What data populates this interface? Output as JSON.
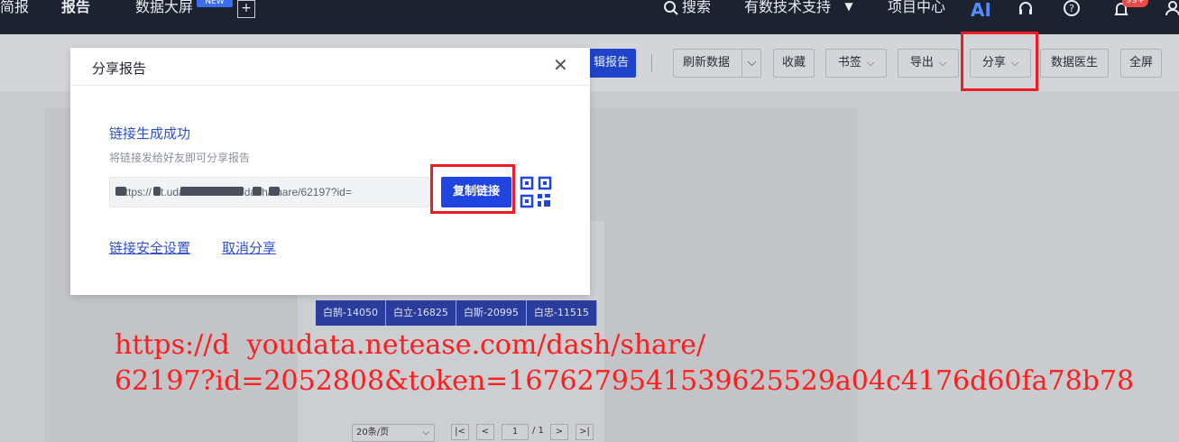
{
  "nav": {
    "item_partial": "简报",
    "item_report": "报告",
    "item_dashboard": "数据大屏",
    "badge_new": "NEW",
    "search": "搜索",
    "support": "有数技术支持",
    "project_center": "项目中心",
    "ai": "AI",
    "notification_count": "99+"
  },
  "toolbar": {
    "edit_report_partial": "辑报告",
    "refresh": "刷新数据",
    "favorite": "收藏",
    "bookmark": "书签",
    "export": "导出",
    "share": "分享",
    "data_doctor": "数据医生",
    "fullscreen": "全屏"
  },
  "content": {
    "tags": [
      "白鹄-14050",
      "白立-16825",
      "白斯-20995",
      "白忠-11515"
    ],
    "pager": {
      "page_size": "20条/页",
      "first": "|<",
      "prev": "<",
      "current": "1",
      "total": "/ 1",
      "next": ">",
      "last": ">|"
    }
  },
  "modal": {
    "title": "分享报告",
    "success_title": "链接生成成功",
    "hint": "将链接发给好友即可分享报告",
    "link_value": "https://   dt.udata.neteas   m/dash/share/62197?id=",
    "copy_button": "复制链接",
    "security_settings": "链接安全设置",
    "cancel_share": "取消分享"
  },
  "overlay_url": {
    "line1": "https://d  youdata.netease.com/dash/share/",
    "line2": "62197?id=2052808&token=1676279541539625529a04c4176d60fa78b78"
  },
  "colors": {
    "accent": "#1f44e0",
    "highlight_frame": "#ee1c25",
    "overlay_text": "#ff1e1e",
    "nav_bg": "#1d2230"
  }
}
